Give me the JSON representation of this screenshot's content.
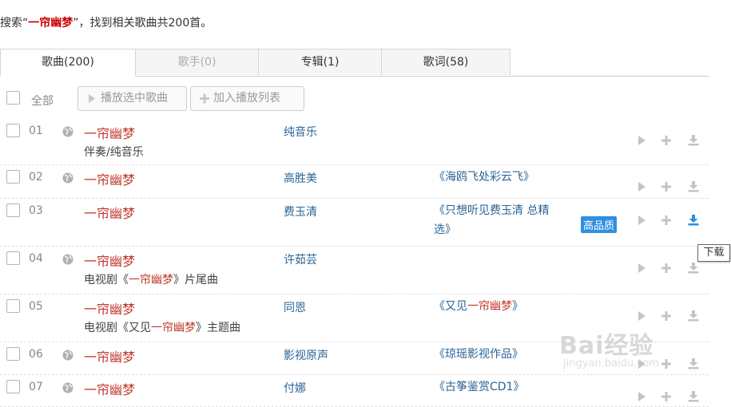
{
  "summary": {
    "prefix": "搜索“",
    "keyword": "一帘幽梦",
    "suffix": "”，找到相关歌曲共200首。"
  },
  "tabs": [
    {
      "label": "歌曲(200)",
      "state": "active"
    },
    {
      "label": "歌手(0)",
      "state": "disabled"
    },
    {
      "label": "专辑(1)",
      "state": "normal"
    },
    {
      "label": "歌词(58)",
      "state": "normal"
    }
  ],
  "toolbar": {
    "select_all": "全部",
    "play_selected": "播放选中歌曲",
    "add_to_playlist": "加入播放列表"
  },
  "songs": [
    {
      "num": "01",
      "title": "一帘幽梦",
      "sub": [
        "伴奏/纯音乐"
      ],
      "artist": "纯音乐",
      "album": [],
      "hq": ""
    },
    {
      "num": "02",
      "title": "一帘幽梦",
      "sub": [],
      "artist": "高胜美",
      "album": [
        "《海鸥飞处彩云飞》"
      ],
      "hq": ""
    },
    {
      "num": "03",
      "title": "一帘幽梦",
      "sub": [],
      "artist": "费玉清",
      "album": [
        "《只想听见费玉清 总精选》"
      ],
      "hq": "高品质"
    },
    {
      "num": "04",
      "title": "一帘幽梦",
      "sub": [
        "电视剧《",
        "一帘幽梦",
        "》片尾曲"
      ],
      "artist": "许茹芸",
      "album": [],
      "hq": ""
    },
    {
      "num": "05",
      "title": "一帘幽梦",
      "sub": [
        "电视剧《又见",
        "一帘幽梦",
        "》主题曲"
      ],
      "artist": "同恩",
      "album": [
        "《又见",
        "一帘幽梦",
        "》"
      ],
      "hq": ""
    },
    {
      "num": "06",
      "title": "一帘幽梦",
      "sub": [],
      "artist": "影视原声",
      "album": [
        "《琼瑶影视作品》"
      ],
      "hq": ""
    },
    {
      "num": "07",
      "title": "一帘幽梦",
      "sub": [],
      "artist": "付娜",
      "album": [
        "《古筝鉴赏CD1》"
      ],
      "hq": ""
    }
  ],
  "tooltip": "下载",
  "watermark": {
    "main": "Bai经验",
    "sub": "jingyan.baidu.com"
  },
  "colors": {
    "keyword": "#c00000",
    "link": "#2a6496",
    "hq_badge": "#2f8fe0",
    "download_hover": "#2f8fe0"
  }
}
